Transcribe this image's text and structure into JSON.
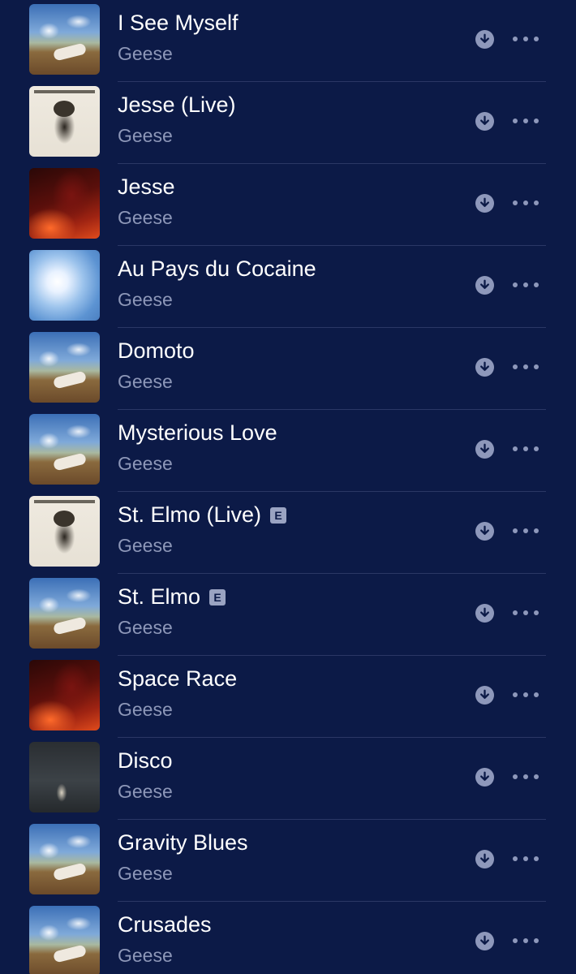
{
  "songs": [
    {
      "title": "I See Myself",
      "artist": "Geese",
      "explicit": "",
      "artwork": "art-a-icon"
    },
    {
      "title": "Jesse (Live)",
      "artist": "Geese",
      "explicit": "",
      "artwork": "art-b-icon"
    },
    {
      "title": "Jesse",
      "artist": "Geese",
      "explicit": "",
      "artwork": "art-c-icon"
    },
    {
      "title": "Au Pays du Cocaine",
      "artist": "Geese",
      "explicit": "",
      "artwork": "art-d-icon"
    },
    {
      "title": "Domoto",
      "artist": "Geese",
      "explicit": "",
      "artwork": "art-a-icon"
    },
    {
      "title": "Mysterious Love",
      "artist": "Geese",
      "explicit": "",
      "artwork": "art-a-icon"
    },
    {
      "title": "St. Elmo (Live)",
      "artist": "Geese",
      "explicit": "E",
      "artwork": "art-b-icon"
    },
    {
      "title": "St. Elmo",
      "artist": "Geese",
      "explicit": "E",
      "artwork": "art-a-icon"
    },
    {
      "title": "Space Race",
      "artist": "Geese",
      "explicit": "",
      "artwork": "art-c-icon"
    },
    {
      "title": "Disco",
      "artist": "Geese",
      "explicit": "",
      "artwork": "art-e-icon"
    },
    {
      "title": "Gravity Blues",
      "artist": "Geese",
      "explicit": "",
      "artwork": "art-a-icon"
    },
    {
      "title": "Crusades",
      "artist": "Geese",
      "explicit": "",
      "artwork": "art-a-icon"
    }
  ],
  "colors": {
    "background": "#0c1a47",
    "title_text": "#ffffff",
    "artist_text": "#8d97b8",
    "icon": "#8e98bb"
  },
  "icons": {
    "download": "download-icon",
    "more": "more-options-icon"
  }
}
